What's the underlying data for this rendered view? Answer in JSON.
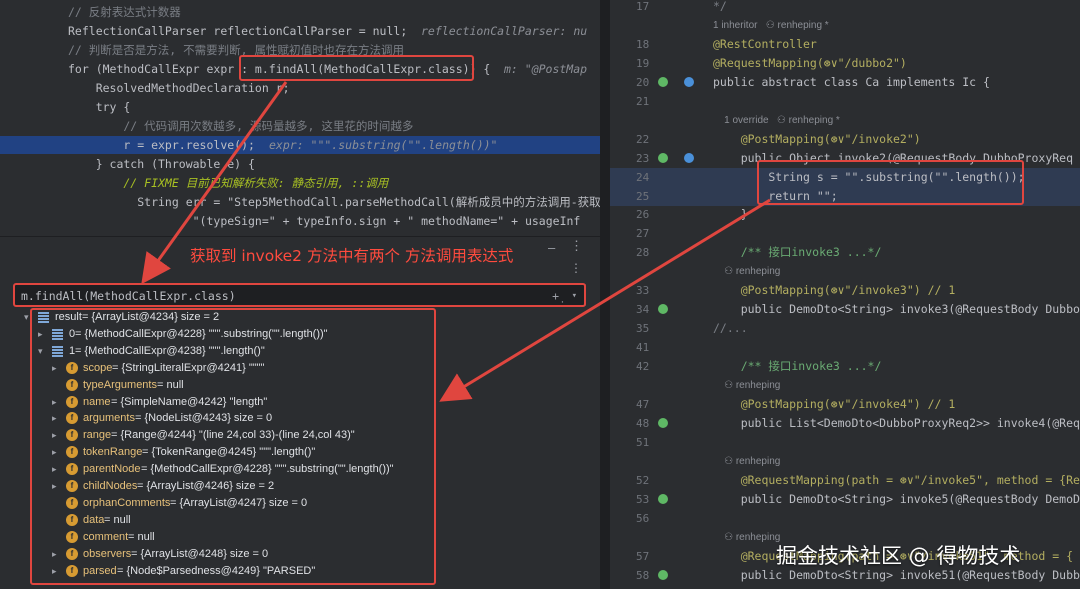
{
  "left_editor": {
    "lines": [
      {
        "cls": "cm",
        "text": "// 反射表达式计数器"
      },
      {
        "cls": "",
        "text": "ReflectionCallParser reflectionCallParser = null;",
        "hint": "reflectionCallParser: nu"
      },
      {
        "cls": "cm",
        "text": "// 判断是否是方法, 不需要判断, 属性赋初值时也存在方法调用"
      },
      {
        "cls": "",
        "text": "for (MethodCallExpr expr : m.findAll(MethodCallExpr.class)) {",
        "hint": "m: \"@PostMap"
      },
      {
        "cls": "",
        "text": "    ResolvedMethodDeclaration r;"
      },
      {
        "cls": "",
        "text": "    try {"
      },
      {
        "cls": "cm",
        "text": "        // 代码调用次数越多, 源码量越多, 这里花的时间越多"
      },
      {
        "cls": "",
        "text": "        r = expr.resolve();",
        "hint": "expr: \"\"\".substring(\"\".length())\""
      },
      {
        "cls": "",
        "text": "    } catch (Throwable e) {"
      },
      {
        "cls": "todo",
        "text": "        // FIXME 目前已知解析失败: 静态引用, ::调用"
      },
      {
        "cls": "",
        "text": "          String err = \"Step5MethodCall.parseMethodCall(解析成员中的方法调用-获取"
      },
      {
        "cls": "",
        "text": "                  \"(typeSign=\" + typeInfo.sign + \" methodName=\" + usageInf"
      }
    ]
  },
  "debug": {
    "expression": "m.findAll(MethodCallExpr.class)",
    "callout": "获取到 invoke2 方法中有两个 方法调用表达式",
    "rows": [
      {
        "indent": 0,
        "chev": "▾",
        "icon": "list",
        "name": "result",
        "rest": " = {ArrayList@4234}  size = 2"
      },
      {
        "indent": 1,
        "chev": "▸",
        "icon": "list",
        "name": "0",
        "rest": " = {MethodCallExpr@4228} \"\"\".substring(\"\".length())\""
      },
      {
        "indent": 1,
        "chev": "▾",
        "icon": "list",
        "name": "1",
        "rest": " = {MethodCallExpr@4238} \"\"\".length()\""
      },
      {
        "indent": 2,
        "chev": "▸",
        "icon": "field",
        "name": "scope",
        "rest": " = {StringLiteralExpr@4241} \"\"\"\""
      },
      {
        "indent": 2,
        "chev": "",
        "icon": "field",
        "name": "typeArguments",
        "rest": " = null"
      },
      {
        "indent": 2,
        "chev": "▸",
        "icon": "field",
        "name": "name",
        "rest": " = {SimpleName@4242} \"length\""
      },
      {
        "indent": 2,
        "chev": "▸",
        "icon": "field",
        "name": "arguments",
        "rest": " = {NodeList@4243}  size = 0"
      },
      {
        "indent": 2,
        "chev": "▸",
        "icon": "field",
        "name": "range",
        "rest": " = {Range@4244} \"(line 24,col 33)-(line 24,col 43)\""
      },
      {
        "indent": 2,
        "chev": "▸",
        "icon": "field",
        "name": "tokenRange",
        "rest": " = {TokenRange@4245} \"\"\".length()\""
      },
      {
        "indent": 2,
        "chev": "▸",
        "icon": "field",
        "name": "parentNode",
        "rest": " = {MethodCallExpr@4228} \"\"\".substring(\"\".length())\""
      },
      {
        "indent": 2,
        "chev": "▸",
        "icon": "field",
        "name": "childNodes",
        "rest": " = {ArrayList@4246}  size = 2"
      },
      {
        "indent": 2,
        "chev": "",
        "icon": "field",
        "name": "orphanComments",
        "rest": " = {ArrayList@4247}  size = 0"
      },
      {
        "indent": 2,
        "chev": "",
        "icon": "field",
        "name": "data",
        "rest": " = null"
      },
      {
        "indent": 2,
        "chev": "",
        "icon": "field",
        "name": "comment",
        "rest": " = null"
      },
      {
        "indent": 2,
        "chev": "▸",
        "icon": "field",
        "name": "observers",
        "rest": " = {ArrayList@4248}  size = 0"
      },
      {
        "indent": 2,
        "chev": "▸",
        "icon": "field",
        "name": "parsed",
        "rest": " = {Node$Parsedness@4249} \"PARSED\""
      }
    ]
  },
  "right_editor": {
    "lines": [
      {
        "num": "17",
        "code": "*/",
        "cls": "cm"
      },
      {
        "num": "",
        "meta": "1 inheritor   ⚇ renheping *"
      },
      {
        "num": "18",
        "code": "@RestController",
        "cls": "ann"
      },
      {
        "num": "19",
        "code": "@RequestMapping(⊛∨\"/dubbo2\")",
        "cls": "ann"
      },
      {
        "num": "20",
        "code": "public abstract class Ca implements Ic {",
        "cls": ""
      },
      {
        "num": "21",
        "code": "",
        "cls": ""
      },
      {
        "num": "",
        "meta": "    1 override   ⚇ renheping *"
      },
      {
        "num": "22",
        "code": "    @PostMapping(⊛∨\"/invoke2\")",
        "cls": "ann"
      },
      {
        "num": "23",
        "code": "    public Object invoke2(@RequestBody DubboProxyReq r",
        "cls": ""
      },
      {
        "num": "24",
        "code": "        String s = \"\".substring(\"\".length());",
        "cls": ""
      },
      {
        "num": "25",
        "code": "        return \"\";",
        "cls": ""
      },
      {
        "num": "26",
        "code": "    }",
        "cls": ""
      },
      {
        "num": "27",
        "code": "",
        "cls": ""
      },
      {
        "num": "28",
        "code": "    /** 接口invoke3 ...*/",
        "cls": "str"
      },
      {
        "num": "",
        "meta": "    ⚇ renheping"
      },
      {
        "num": "33",
        "code": "    @PostMapping(⊛∨\"/invoke3\") // 1",
        "cls": "ann"
      },
      {
        "num": "34",
        "code": "    public DemoDto<String> invoke3(@RequestBody DubboPr",
        "cls": ""
      },
      {
        "num": "35",
        "code": "//...",
        "cls": "cm"
      },
      {
        "num": "41",
        "code": "",
        "cls": ""
      },
      {
        "num": "42",
        "code": "    /** 接口invoke3 ...*/",
        "cls": "str"
      },
      {
        "num": "",
        "meta": "    ⚇ renheping"
      },
      {
        "num": "47",
        "code": "    @PostMapping(⊛∨\"/invoke4\") // 1",
        "cls": "ann"
      },
      {
        "num": "48",
        "code": "    public List<DemoDto<DubboProxyReq2>> invoke4(@Requ",
        "cls": ""
      },
      {
        "num": "51",
        "code": "",
        "cls": ""
      },
      {
        "num": "",
        "meta": "    ⚇ renheping"
      },
      {
        "num": "52",
        "code": "    @RequestMapping(path = ⊛∨\"/invoke5\", method = {Re",
        "cls": "ann"
      },
      {
        "num": "53",
        "code": "    public DemoDto<String> invoke5(@RequestBody DemoDt",
        "cls": ""
      },
      {
        "num": "56",
        "code": "",
        "cls": ""
      },
      {
        "num": "",
        "meta": "    ⚇ renheping"
      },
      {
        "num": "57",
        "code": "    @RequestMapping(path = ⊛∨\"/invoke51\", method = {",
        "cls": "ann"
      },
      {
        "num": "58",
        "code": "    public DemoDto<String> invoke51(@RequestBody Dubbo",
        "cls": ""
      }
    ]
  },
  "watermark": "掘金技术社区 @ 得物技术"
}
